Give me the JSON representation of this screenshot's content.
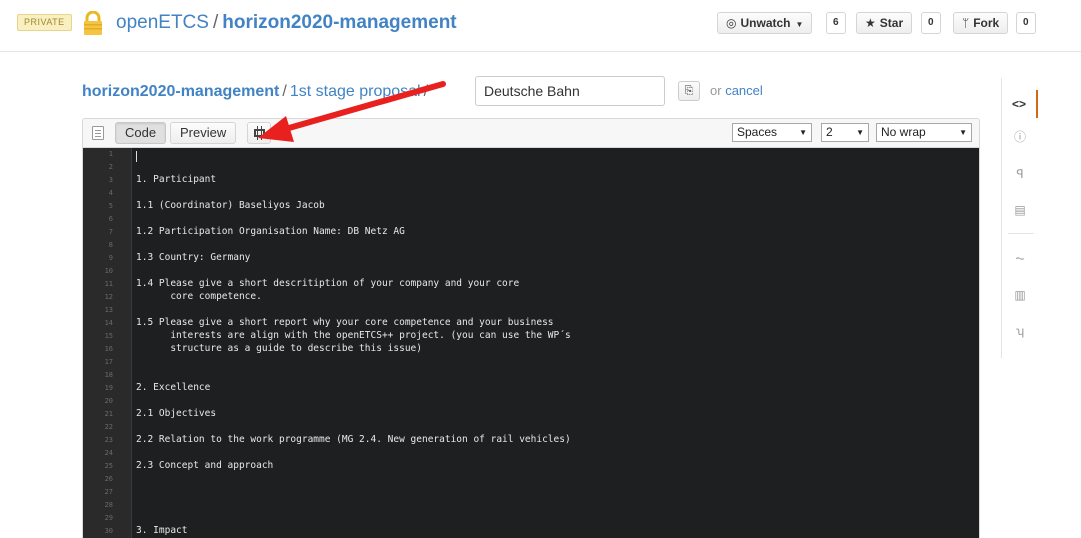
{
  "header": {
    "private_label": "PRIVATE",
    "owner": "openETCS",
    "separator": "/",
    "repo": "horizon2020-management",
    "unwatch_label": "Unwatch",
    "unwatch_count": "6",
    "star_label": "Star",
    "star_count": "0",
    "fork_label": "Fork",
    "fork_count": "0",
    "lock_color": "#f5c542"
  },
  "breadcrumb": {
    "root": "horizon2020-management",
    "folder": "1st stage proposal",
    "sep1": "/",
    "sep2": "/",
    "filename_value": "Deutsche Bahn",
    "or_text": "or",
    "cancel_label": "cancel"
  },
  "toolbar": {
    "code_tab": "Code",
    "preview_tab": "Preview",
    "indent_mode": "Spaces",
    "indent_size": "2",
    "wrap_mode": "No wrap"
  },
  "code_lines": [
    {
      "n": "1",
      "t": ""
    },
    {
      "n": "2",
      "t": ""
    },
    {
      "n": "3",
      "t": "1. Participant"
    },
    {
      "n": "4",
      "t": ""
    },
    {
      "n": "5",
      "t": "1.1 (Coordinator) Baseliyos Jacob"
    },
    {
      "n": "6",
      "t": ""
    },
    {
      "n": "7",
      "t": "1.2 Participation Organisation Name: DB Netz AG"
    },
    {
      "n": "8",
      "t": ""
    },
    {
      "n": "9",
      "t": "1.3 Country: Germany"
    },
    {
      "n": "10",
      "t": ""
    },
    {
      "n": "11",
      "t": "1.4 Please give a short descritiption of your company and your core"
    },
    {
      "n": "12",
      "t": "      core competence."
    },
    {
      "n": "13",
      "t": ""
    },
    {
      "n": "14",
      "t": "1.5 Please give a short report why your core competence and your business"
    },
    {
      "n": "15",
      "t": "      interests are align with the openETCS++ project. (you can use the WP´s"
    },
    {
      "n": "16",
      "t": "      structure as a guide to describe this issue)"
    },
    {
      "n": "17",
      "t": ""
    },
    {
      "n": "18",
      "t": ""
    },
    {
      "n": "19",
      "t": "2. Excellence"
    },
    {
      "n": "20",
      "t": ""
    },
    {
      "n": "21",
      "t": "2.1 Objectives"
    },
    {
      "n": "22",
      "t": ""
    },
    {
      "n": "23",
      "t": "2.2 Relation to the work programme (MG 2.4. New generation of rail vehicles)"
    },
    {
      "n": "24",
      "t": ""
    },
    {
      "n": "25",
      "t": "2.3 Concept and approach"
    },
    {
      "n": "26",
      "t": ""
    },
    {
      "n": "27",
      "t": ""
    },
    {
      "n": "28",
      "t": ""
    },
    {
      "n": "29",
      "t": ""
    },
    {
      "n": "30",
      "t": "3. Impact"
    }
  ],
  "sidebar": {
    "items": [
      {
        "icon": "code-icon",
        "glyph": "<>"
      },
      {
        "icon": "issues-icon",
        "glyph": "ⓘ"
      },
      {
        "icon": "pull-requests-icon",
        "glyph": "ꟼ"
      },
      {
        "icon": "wiki-icon",
        "glyph": "▤"
      },
      {
        "icon": "pulse-icon",
        "glyph": "⏦"
      },
      {
        "icon": "graphs-icon",
        "glyph": "▥"
      },
      {
        "icon": "network-icon",
        "glyph": "ʮ"
      }
    ]
  },
  "colors": {
    "link": "#4183c4",
    "editor_bg": "#1d1f21",
    "annotation_arrow": "#e8201e",
    "active_accent": "#d26911"
  }
}
